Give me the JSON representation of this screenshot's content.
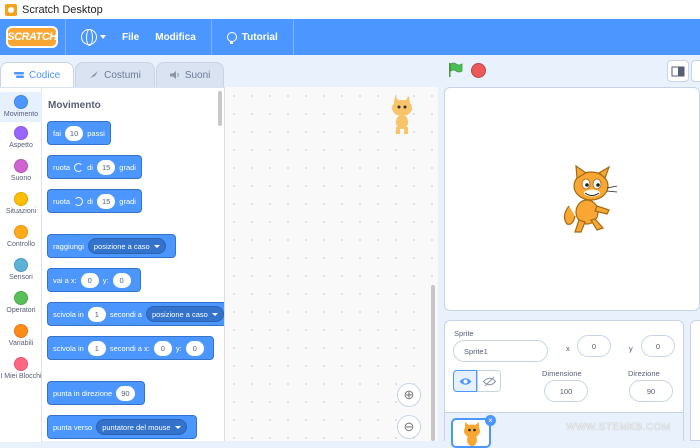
{
  "window": {
    "title": "Scratch Desktop"
  },
  "menubar": {
    "logo": "SCRATCH",
    "file": "File",
    "edit": "Modifica",
    "tutorial": "Tutorial"
  },
  "tabs": [
    {
      "label": "Codice"
    },
    {
      "label": "Costumi"
    },
    {
      "label": "Suoni"
    }
  ],
  "categories": [
    {
      "label": "Movimento",
      "color": "#4c97ff"
    },
    {
      "label": "Aspetto",
      "color": "#9966ff"
    },
    {
      "label": "Suono",
      "color": "#cf63cf"
    },
    {
      "label": "Situazioni",
      "color": "#ffbf00"
    },
    {
      "label": "Controllo",
      "color": "#ffab19"
    },
    {
      "label": "Sensori",
      "color": "#5cb1d6"
    },
    {
      "label": "Operatori",
      "color": "#59c059"
    },
    {
      "label": "Variabili",
      "color": "#ff8c1a"
    },
    {
      "label": "I Miei Blocchi",
      "color": "#ff6680"
    }
  ],
  "palette": {
    "section_title": "Movimento",
    "blocks": {
      "move": {
        "a": "fai",
        "steps": "10",
        "b": "passi"
      },
      "turn_right": {
        "a": "ruota",
        "b": "di",
        "deg": "15",
        "c": "gradi"
      },
      "turn_left": {
        "a": "ruota",
        "b": "di",
        "deg": "15",
        "c": "gradi"
      },
      "goto": {
        "a": "raggiungi",
        "target": "posizione a caso"
      },
      "goto_xy": {
        "a": "vai a x:",
        "x": "0",
        "b": "y:",
        "y": "0"
      },
      "glide": {
        "a": "scivola in",
        "secs": "1",
        "b": "secondi a",
        "target": "posizione a caso"
      },
      "glide_xy": {
        "a": "scivola in",
        "secs": "1",
        "b": "secondi a x:",
        "x": "0",
        "c": "y:",
        "y": "0"
      },
      "point_dir": {
        "a": "punta in direzione",
        "dir": "90"
      },
      "point_towards": {
        "a": "punta verso",
        "target": "puntatore del mouse"
      }
    }
  },
  "sprite_info": {
    "sprite_label": "Sprite",
    "sprite_name": "Sprite1",
    "x_label": "x",
    "x_value": "0",
    "y_label": "y",
    "y_value": "0",
    "show_label": "Mostra",
    "size_label": "Dimensione",
    "size_value": "100",
    "direction_label": "Direzione",
    "direction_value": "90"
  },
  "watermark": "WWW.STEMKB.COM"
}
